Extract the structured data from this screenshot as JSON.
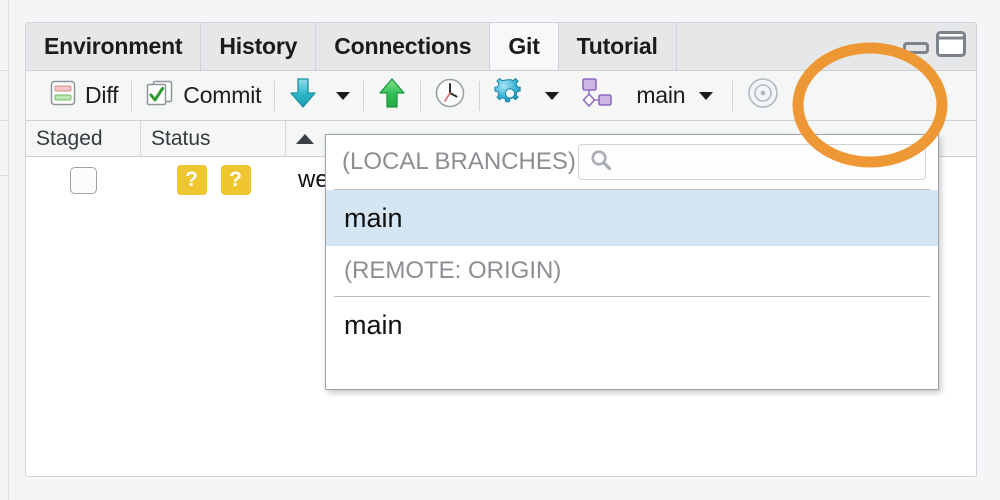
{
  "app": {
    "active_tab": "Git"
  },
  "tabs": [
    {
      "label": "Environment",
      "active": false
    },
    {
      "label": "History",
      "active": false
    },
    {
      "label": "Connections",
      "active": false
    },
    {
      "label": "Git",
      "active": true
    },
    {
      "label": "Tutorial",
      "active": false
    }
  ],
  "window_controls": [
    {
      "name": "minimize-pane-button",
      "icon": "minimize-icon"
    },
    {
      "name": "maximize-pane-button",
      "icon": "maximize-icon"
    }
  ],
  "toolbar": {
    "diff_label": "Diff",
    "diff_icon": "diff-icon",
    "commit_label": "Commit",
    "commit_icon": "commit-checkbox-icon",
    "pull_icon": "pull-down-arrow-icon",
    "pull_caret_icon": "chevron-down-icon",
    "push_icon": "push-up-arrow-icon",
    "history_icon": "clock-history-icon",
    "gear_icon": "gear-icon",
    "gear_caret_icon": "chevron-down-icon",
    "branch_network_icon": "branch-network-icon",
    "branch_label": "main",
    "branch_caret_icon": "chevron-down-icon",
    "refresh_icon": "refresh-icon"
  },
  "table": {
    "columns": [
      {
        "key": "staged",
        "label": "Staged",
        "sorted": false
      },
      {
        "key": "status",
        "label": "Status",
        "sorted": false
      },
      {
        "key": "path",
        "label": "",
        "sorted": true,
        "sort_dir": "asc"
      }
    ],
    "rows": [
      {
        "staged_checked": false,
        "status_badges": [
          "?",
          "?"
        ],
        "path": "we"
      }
    ]
  },
  "branch_popup": {
    "local_caption": "(LOCAL BRANCHES)",
    "search_value": "",
    "search_placeholder": "",
    "search_icon": "search-icon",
    "local_branches": [
      {
        "label": "main",
        "selected": true
      }
    ],
    "remote_caption": "(REMOTE: ORIGIN)",
    "remote_branches": [
      {
        "label": "main",
        "selected": false
      }
    ]
  },
  "annotation": {
    "shape": "ellipse",
    "color": "#ee9835",
    "target": "branch-dropdown-button"
  },
  "colors": {
    "annotation_orange": "#ee9835",
    "selection_blue": "#d4e5f3",
    "status_badge_yellow": "#eec62f",
    "pane_background": "#ffffff",
    "toolbar_background": "#f4f7f6",
    "tabstrip_background": "#e6e7e9"
  }
}
